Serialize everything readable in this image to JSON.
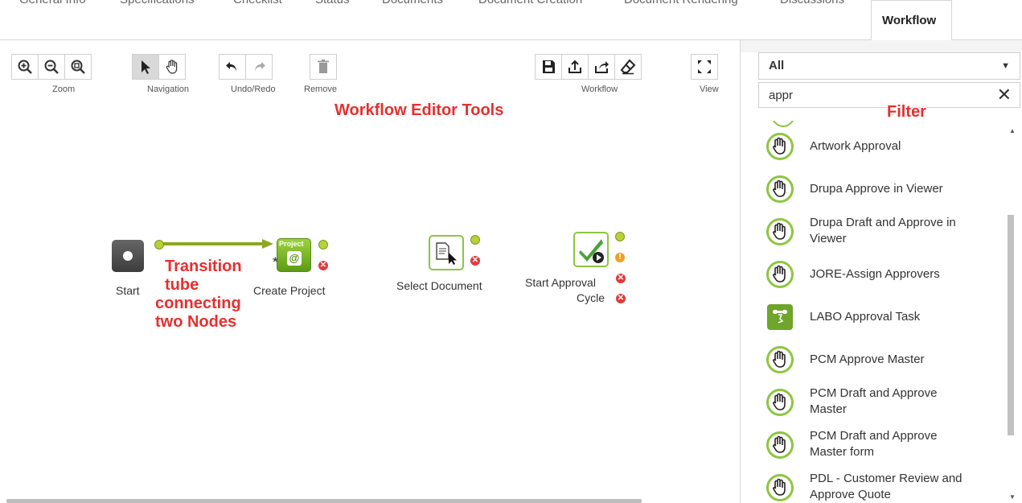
{
  "tabs": [
    {
      "label": "General Info"
    },
    {
      "label": "Specifications"
    },
    {
      "label": "Checklist"
    },
    {
      "label": "Status"
    },
    {
      "label": "Documents"
    },
    {
      "label": "Document Creation"
    },
    {
      "label": "Document Rendering"
    },
    {
      "label": "Discussions"
    },
    {
      "label": "Workflow",
      "active": true
    }
  ],
  "toolbar": {
    "zoom_label": "Zoom",
    "navigation_label": "Navigation",
    "undo_redo_label": "Undo/Redo",
    "remove_label": "Remove",
    "workflow_label": "Workflow",
    "view_label": "View"
  },
  "annotations": {
    "tools": "Workflow Editor Tools",
    "filter": "Filter",
    "transition_1": "Transition",
    "transition_2": "tube",
    "transition_3": "connecting",
    "transition_4": "two Nodes"
  },
  "nodes": {
    "start": "Start",
    "create_project": "Create Project",
    "project_badge": "Project",
    "select_document": "Select Document",
    "start_approval_1": "Start Approval",
    "start_approval_2": "Cycle"
  },
  "filter": {
    "category": "All",
    "search_value": "appr"
  },
  "items": [
    {
      "label_1": "Artwork Approval",
      "label_2": "",
      "icon": "hand-icon"
    },
    {
      "label_1": "Drupa Approve in Viewer",
      "label_2": "",
      "icon": "hand-icon"
    },
    {
      "label_1": "Drupa Draft and Approve in",
      "label_2": "Viewer",
      "icon": "hand-icon"
    },
    {
      "label_1": "JORE-Assign Approvers",
      "label_2": "",
      "icon": "hand-icon"
    },
    {
      "label_1": "LABO Approval Task",
      "label_2": "",
      "icon": "task-icon"
    },
    {
      "label_1": "PCM Approve Master",
      "label_2": "",
      "icon": "hand-icon"
    },
    {
      "label_1": "PCM Draft and Approve",
      "label_2": "Master",
      "icon": "hand-icon"
    },
    {
      "label_1": "PCM Draft and Approve",
      "label_2": "Master form",
      "icon": "hand-icon"
    },
    {
      "label_1": "PDL - Customer Review and",
      "label_2": "Approve Quote",
      "icon": "hand-icon"
    }
  ],
  "colors": {
    "accent_green": "#8dc63f",
    "error_red": "#e23a3a",
    "annotation_red": "#e52f2f"
  }
}
